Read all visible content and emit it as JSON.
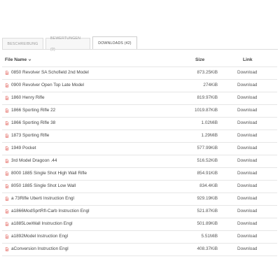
{
  "tabs": [
    {
      "label": "BESCHREIBUNG"
    },
    {
      "label": "BEWERTUNGEN (0)"
    },
    {
      "label": "DOWNLOADS (42)"
    }
  ],
  "table": {
    "headers": {
      "name": "File Name",
      "size": "Size",
      "link": "Link"
    },
    "rows": [
      {
        "name": "0850 Revolver SA Schofield 2nd Model",
        "size": "873.25KiB",
        "link": "Download"
      },
      {
        "name": "0900 Revolver Open Top Late Model",
        "size": "274KiB",
        "link": "Download"
      },
      {
        "name": "1860 Henry Rifle",
        "size": "819.97KiB",
        "link": "Download"
      },
      {
        "name": "1866 Sporting Rifle 22",
        "size": "1019.87KiB",
        "link": "Download"
      },
      {
        "name": "1866 Sporting Rifle 38",
        "size": "1.02MiB",
        "link": "Download"
      },
      {
        "name": "1873 Sporting Rifle",
        "size": "1.29MiB",
        "link": "Download"
      },
      {
        "name": "1949 Pocket",
        "size": "577.99KiB",
        "link": "Download"
      },
      {
        "name": "3rd Model Dragoon .44",
        "size": "516.52KiB",
        "link": "Download"
      },
      {
        "name": "8000 1885 Single Shot High Wall Rifle",
        "size": "854.91KiB",
        "link": "Download"
      },
      {
        "name": "8050 1885 Single Shot Low Wall",
        "size": "834.4KiB",
        "link": "Download"
      },
      {
        "name": "a 73Rifle Uberti Instruction Engl",
        "size": "929.19KiB",
        "link": "Download"
      },
      {
        "name": "a1866ModSprtRfl-Carb Instruction Engl",
        "size": "521.87KiB",
        "link": "Download"
      },
      {
        "name": "a1885LowWall Instruction Engl",
        "size": "501.89KiB",
        "link": "Download"
      },
      {
        "name": "a1892Model Instruction Engl",
        "size": "5.51MiB",
        "link": "Download"
      },
      {
        "name": "aConversion Instruction Engl",
        "size": "408.37KiB",
        "link": "Download"
      }
    ]
  },
  "icons": {
    "file": "pdf-file-icon",
    "sort": "chevron-down-icon"
  },
  "colors": {
    "pdf_icon": "#d9342b",
    "border": "#e6e6e6"
  }
}
